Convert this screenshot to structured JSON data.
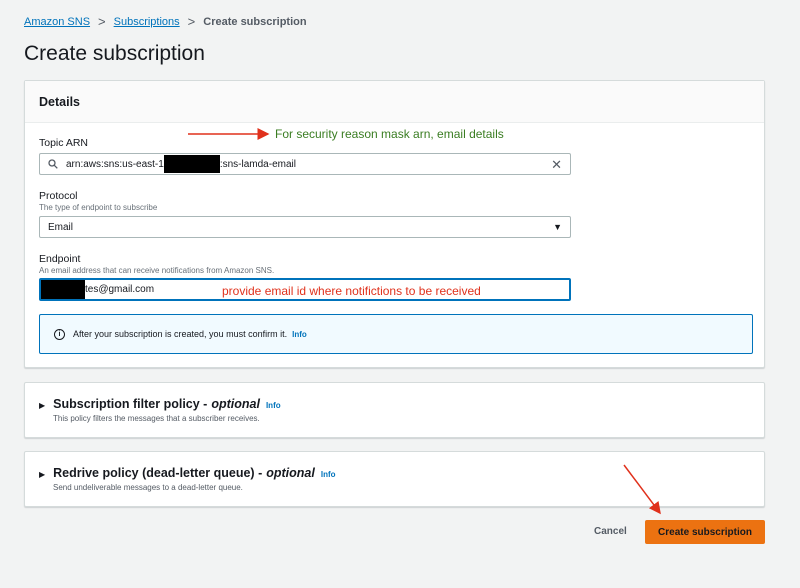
{
  "breadcrumb": {
    "items": [
      "Amazon SNS",
      "Subscriptions"
    ],
    "current": "Create subscription",
    "separator": ">"
  },
  "page": {
    "title": "Create subscription"
  },
  "details": {
    "header": "Details",
    "topic_arn": {
      "label": "Topic ARN",
      "value_prefix": "arn:aws:sns:us-east-1",
      "value_suffix": ":sns-lamda-email"
    },
    "protocol": {
      "label": "Protocol",
      "description": "The type of endpoint to subscribe",
      "value": "Email"
    },
    "endpoint": {
      "label": "Endpoint",
      "description": "An email address that can receive notifications from Amazon SNS.",
      "value_suffix": "tes@gmail.com"
    },
    "info_alert": {
      "text": "After your subscription is created, you must confirm it.",
      "link": "Info"
    }
  },
  "filter_policy": {
    "title": "Subscription filter policy -",
    "optional": "optional",
    "info": "Info",
    "description": "This policy filters the messages that a subscriber receives."
  },
  "redrive_policy": {
    "title": "Redrive policy (dead-letter queue) -",
    "optional": "optional",
    "info": "Info",
    "description": "Send undeliverable messages to a dead-letter queue."
  },
  "actions": {
    "cancel": "Cancel",
    "create": "Create subscription"
  },
  "annotations": {
    "top": "For security reason mask arn, email details",
    "endpoint": "provide email id where notifictions to be received"
  },
  "colors": {
    "link": "#0073bb",
    "primary_button": "#ec7211",
    "annotation_green": "#3a7d22",
    "annotation_red": "#e0311c"
  },
  "icons": [
    "search-icon",
    "close-icon",
    "caret-down-icon",
    "info-circle-icon",
    "caret-right-icon",
    "arrow-right-icon"
  ]
}
